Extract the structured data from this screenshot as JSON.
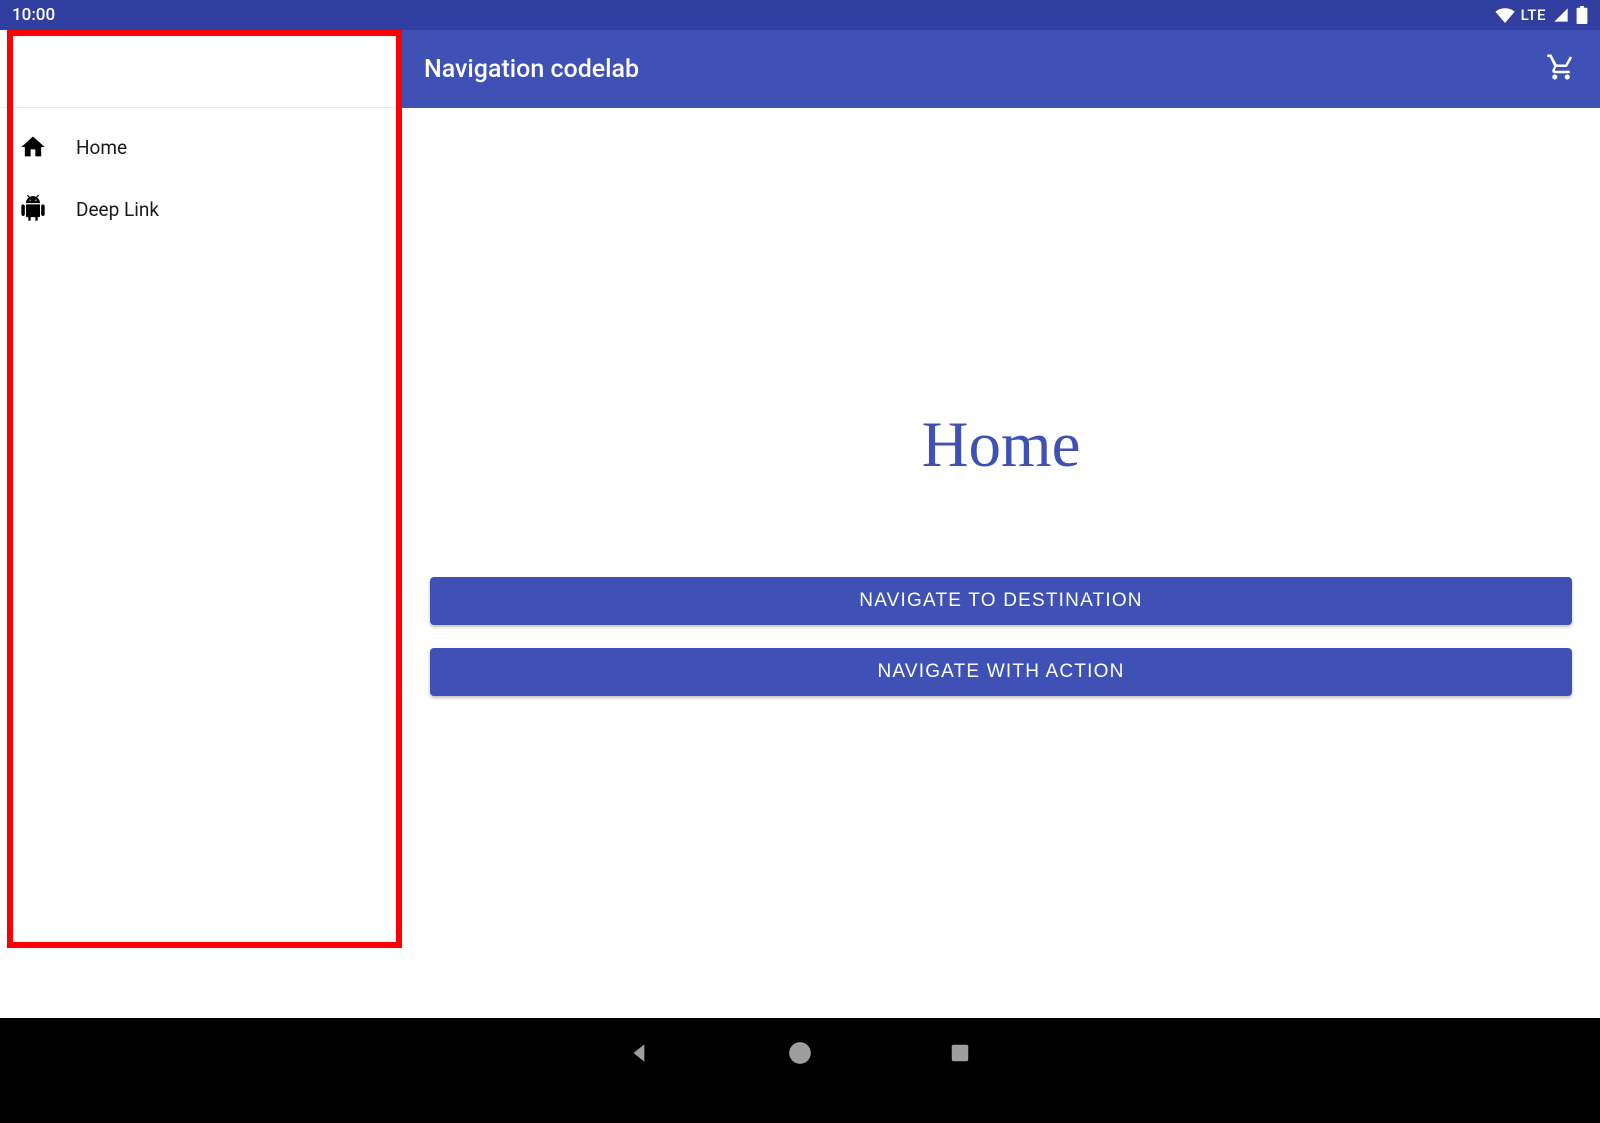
{
  "statusbar": {
    "time": "10:00",
    "network_label": "LTE"
  },
  "drawer": {
    "items": [
      {
        "icon": "home-icon",
        "label": "Home"
      },
      {
        "icon": "android-icon",
        "label": "Deep Link"
      }
    ]
  },
  "appbar": {
    "title": "Navigation codelab",
    "action_icon": "cart-icon"
  },
  "main": {
    "heading": "Home",
    "buttons": [
      {
        "label": "NAVIGATE TO DESTINATION"
      },
      {
        "label": "NAVIGATE WITH ACTION"
      }
    ]
  },
  "system_nav": {
    "back": "back-icon",
    "home": "home-circle-icon",
    "recents": "recents-icon"
  },
  "colors": {
    "primary": "#3f51b5",
    "primary_dark": "#303f9f",
    "highlight": "#ff0000"
  }
}
